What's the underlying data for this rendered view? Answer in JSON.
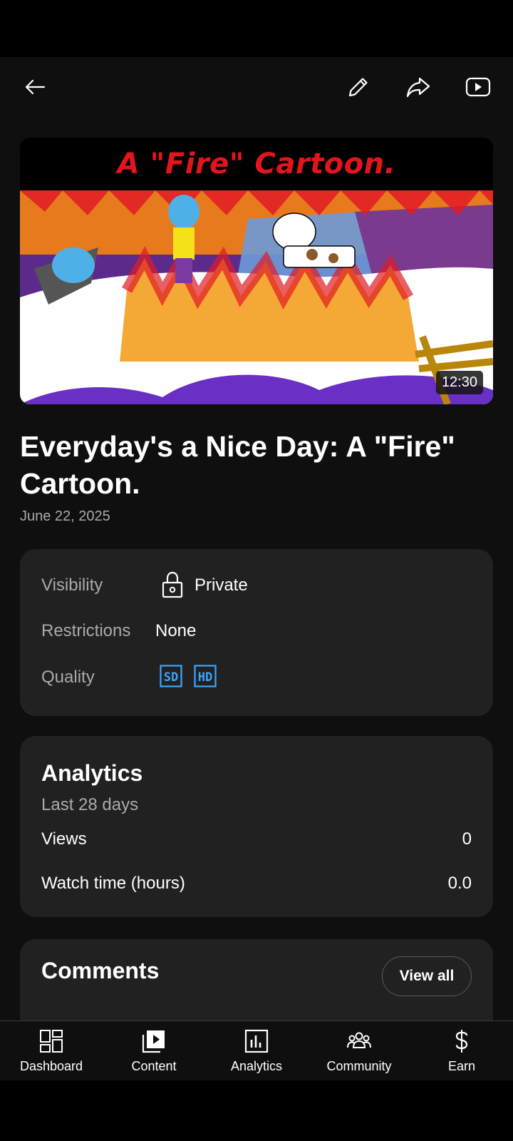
{
  "toolbar": {
    "back_icon": "back-arrow-icon",
    "edit_icon": "pencil-icon",
    "share_icon": "share-icon",
    "watch_icon": "youtube-play-icon"
  },
  "video": {
    "thumbnail_caption": "A \"Fire\" Cartoon.",
    "duration": "12:30",
    "title": "Everyday's a Nice Day: A \"Fire\" Cartoon.",
    "date": "June 22, 2025"
  },
  "details": {
    "visibility_label": "Visibility",
    "visibility_value": "Private",
    "visibility_icon": "lock-icon",
    "restrictions_label": "Restrictions",
    "restrictions_value": "None",
    "quality_label": "Quality",
    "quality_badges": [
      "SD",
      "HD"
    ],
    "badge_color": "#3ea6ff"
  },
  "analytics": {
    "title": "Analytics",
    "period": "Last 28 days",
    "rows": [
      {
        "label": "Views",
        "value": "0"
      },
      {
        "label": "Watch time (hours)",
        "value": "0.0"
      }
    ]
  },
  "comments": {
    "title": "Comments",
    "view_all_label": "View all"
  },
  "nav": {
    "items": [
      {
        "label": "Dashboard",
        "icon": "dashboard-icon"
      },
      {
        "label": "Content",
        "icon": "content-icon"
      },
      {
        "label": "Analytics",
        "icon": "analytics-icon"
      },
      {
        "label": "Community",
        "icon": "community-icon"
      },
      {
        "label": "Earn",
        "icon": "dollar-icon"
      }
    ]
  }
}
